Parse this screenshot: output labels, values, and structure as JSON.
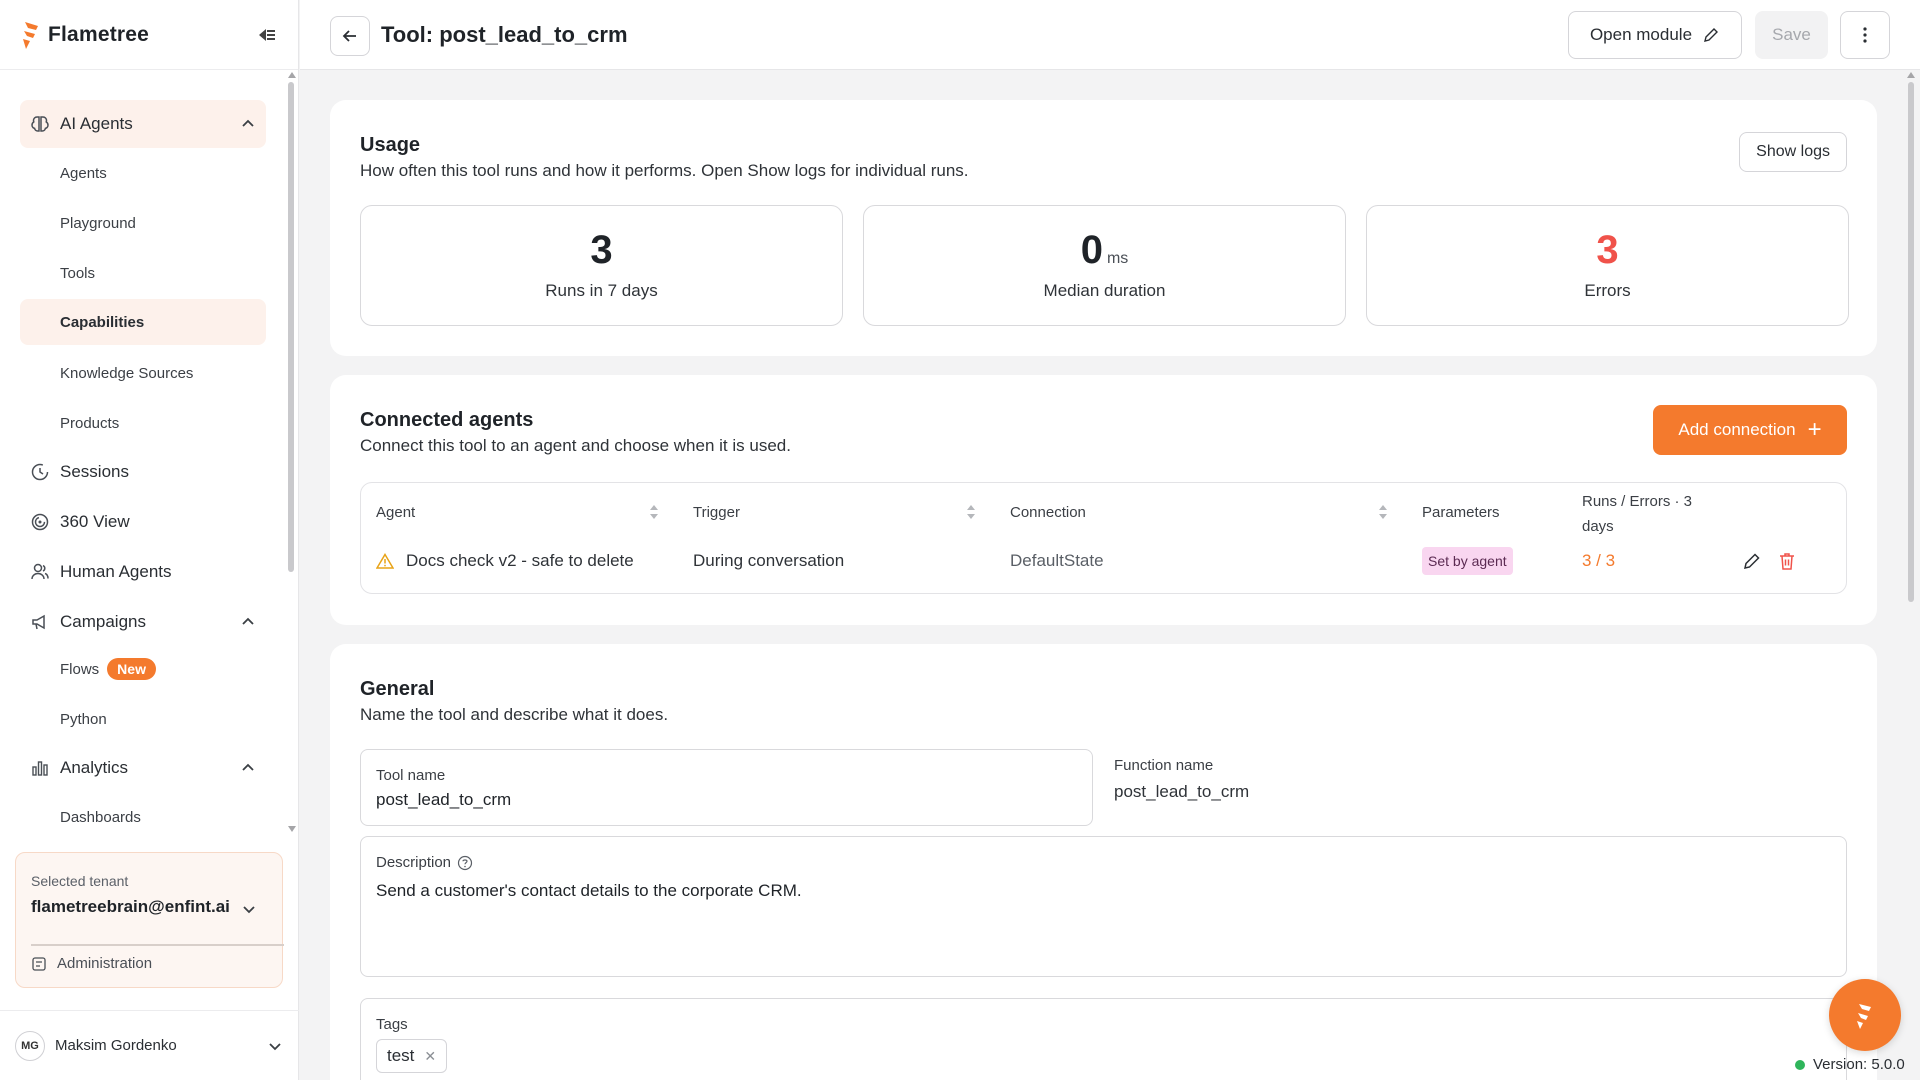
{
  "brand": {
    "name": "Flametree"
  },
  "colors": {
    "accent": "#f47a2d",
    "active_bg": "#fdf1eb",
    "error": "#f0524a",
    "pill_bg": "#f9d6f0",
    "status_ok": "#2fb55b"
  },
  "sidebar": {
    "items": [
      {
        "label": "AI Agents",
        "icon": "brain-icon",
        "expanded": true
      },
      {
        "label": "Agents"
      },
      {
        "label": "Playground"
      },
      {
        "label": "Tools"
      },
      {
        "label": "Capabilities",
        "active": true
      },
      {
        "label": "Knowledge Sources"
      },
      {
        "label": "Products"
      },
      {
        "label": "Sessions",
        "icon": "history-icon"
      },
      {
        "label": "360 View",
        "icon": "spiral-icon"
      },
      {
        "label": "Human Agents",
        "icon": "users-icon"
      },
      {
        "label": "Campaigns",
        "icon": "megaphone-icon",
        "expanded": true
      },
      {
        "label": "Flows",
        "badge": "New"
      },
      {
        "label": "Python"
      },
      {
        "label": "Analytics",
        "icon": "bar-chart-icon",
        "expanded": true
      },
      {
        "label": "Dashboards"
      }
    ],
    "tenant": {
      "label": "Selected tenant",
      "value": "flametreebrain@enfint.ai",
      "admin": "Administration"
    },
    "user": {
      "initials": "MG",
      "name": "Maksim Gordenko"
    }
  },
  "header": {
    "title": "Tool: post_lead_to_crm",
    "open_module": "Open module",
    "save": "Save"
  },
  "usage": {
    "title": "Usage",
    "description": "How often this tool runs and how it performs. Open Show logs for individual runs.",
    "show_logs": "Show logs",
    "stats": [
      {
        "value": "3",
        "unit": "",
        "label": "Runs in 7 days"
      },
      {
        "value": "0",
        "unit": "ms",
        "label": "Median duration"
      },
      {
        "value": "3",
        "unit": "",
        "label": "Errors"
      }
    ]
  },
  "connected": {
    "title": "Connected agents",
    "description": "Connect this tool to an agent and choose when it is used.",
    "add_button": "Add connection",
    "columns": {
      "agent": "Agent",
      "trigger": "Trigger",
      "connection": "Connection",
      "parameters": "Parameters",
      "runs_line1": "Runs / Errors · 3",
      "runs_line2": "days"
    },
    "rows": [
      {
        "agent": "Docs check v2 - safe to delete",
        "trigger": "During conversation",
        "connection": "DefaultState",
        "parameters": "Set by agent",
        "runs": "3 / 3"
      }
    ]
  },
  "general": {
    "title": "General",
    "description": "Name the tool and describe what it does.",
    "tool_name_label": "Tool name",
    "tool_name_value": "post_lead_to_crm",
    "function_name_label": "Function name",
    "function_name_value": "post_lead_to_crm",
    "description_label": "Description",
    "description_value": "Send a customer's contact details to the corporate CRM.",
    "tags_label": "Tags",
    "tags": [
      "test"
    ]
  },
  "footer": {
    "version": "Version: 5.0.0"
  }
}
